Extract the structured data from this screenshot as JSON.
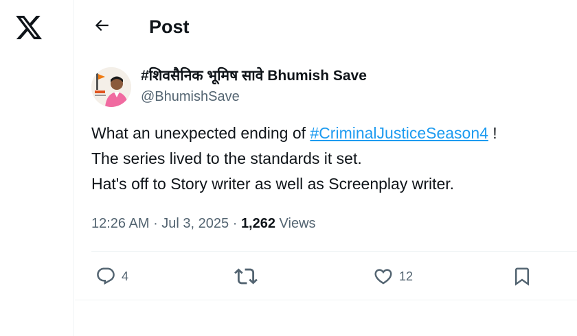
{
  "header": {
    "title": "Post",
    "back_icon": "arrow-left-icon",
    "logo_icon": "x-logo-icon"
  },
  "post": {
    "author": {
      "display_name": "#शिवसैनिक भूमिष सावे Bhumish Save",
      "handle": "@BhumishSave",
      "avatar_icon": "profile-avatar"
    },
    "text": {
      "line1_prefix": "What an unexpected ending of ",
      "hashtag": "#CriminalJusticeSeason4",
      "line1_suffix": " !",
      "line2": "The series lived to the standards it set.",
      "line3": "Hat's off to Story writer as well as Screenplay writer."
    },
    "meta": {
      "time": "12:26 AM",
      "separator1": " · ",
      "date": "Jul 3, 2025",
      "separator2": " · ",
      "views_count": "1,262",
      "views_label": " Views"
    },
    "actions": {
      "replies": "4",
      "reposts": "",
      "likes": "12"
    }
  },
  "colors": {
    "link": "#1d9bf0",
    "muted": "#536471",
    "text": "#0f1419",
    "divider": "#eff3f4"
  }
}
